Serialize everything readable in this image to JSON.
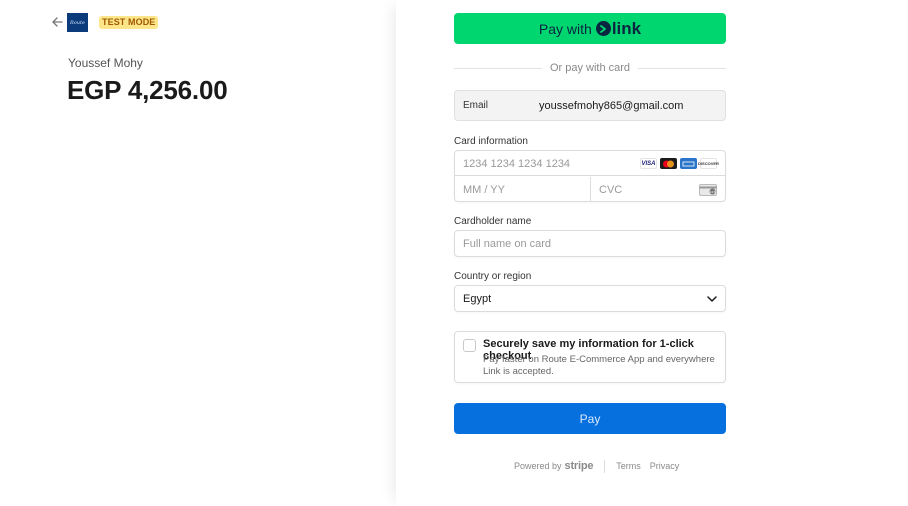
{
  "header": {
    "back_icon": "arrow-left-icon",
    "logo_text": "Route",
    "test_mode_label": "TEST MODE"
  },
  "summary": {
    "merchant_name": "Youssef Mohy",
    "amount": "EGP 4,256.00"
  },
  "link_button": {
    "prefix": "Pay with",
    "brand": "link",
    "color": "#00d66f"
  },
  "divider_text": "Or pay with card",
  "email": {
    "label": "Email",
    "value": "youssefmohy865@gmail.com"
  },
  "card": {
    "label": "Card information",
    "number_placeholder": "1234 1234 1234 1234",
    "expiry_placeholder": "MM / YY",
    "cvc_placeholder": "CVC",
    "brands": [
      "VISA",
      "mastercard",
      "AMEX",
      "DISCOVER"
    ]
  },
  "cardholder": {
    "label": "Cardholder name",
    "placeholder": "Full name on card"
  },
  "country": {
    "label": "Country or region",
    "value": "Egypt"
  },
  "save_info": {
    "title": "Securely save my information for 1-click checkout",
    "description": "Pay faster on Route E-Commerce App and everywhere Link is accepted.",
    "checked": false
  },
  "pay_button": {
    "label": "Pay",
    "color": "#0570de"
  },
  "footer": {
    "powered_by": "Powered by",
    "brand": "stripe",
    "terms": "Terms",
    "privacy": "Privacy"
  }
}
